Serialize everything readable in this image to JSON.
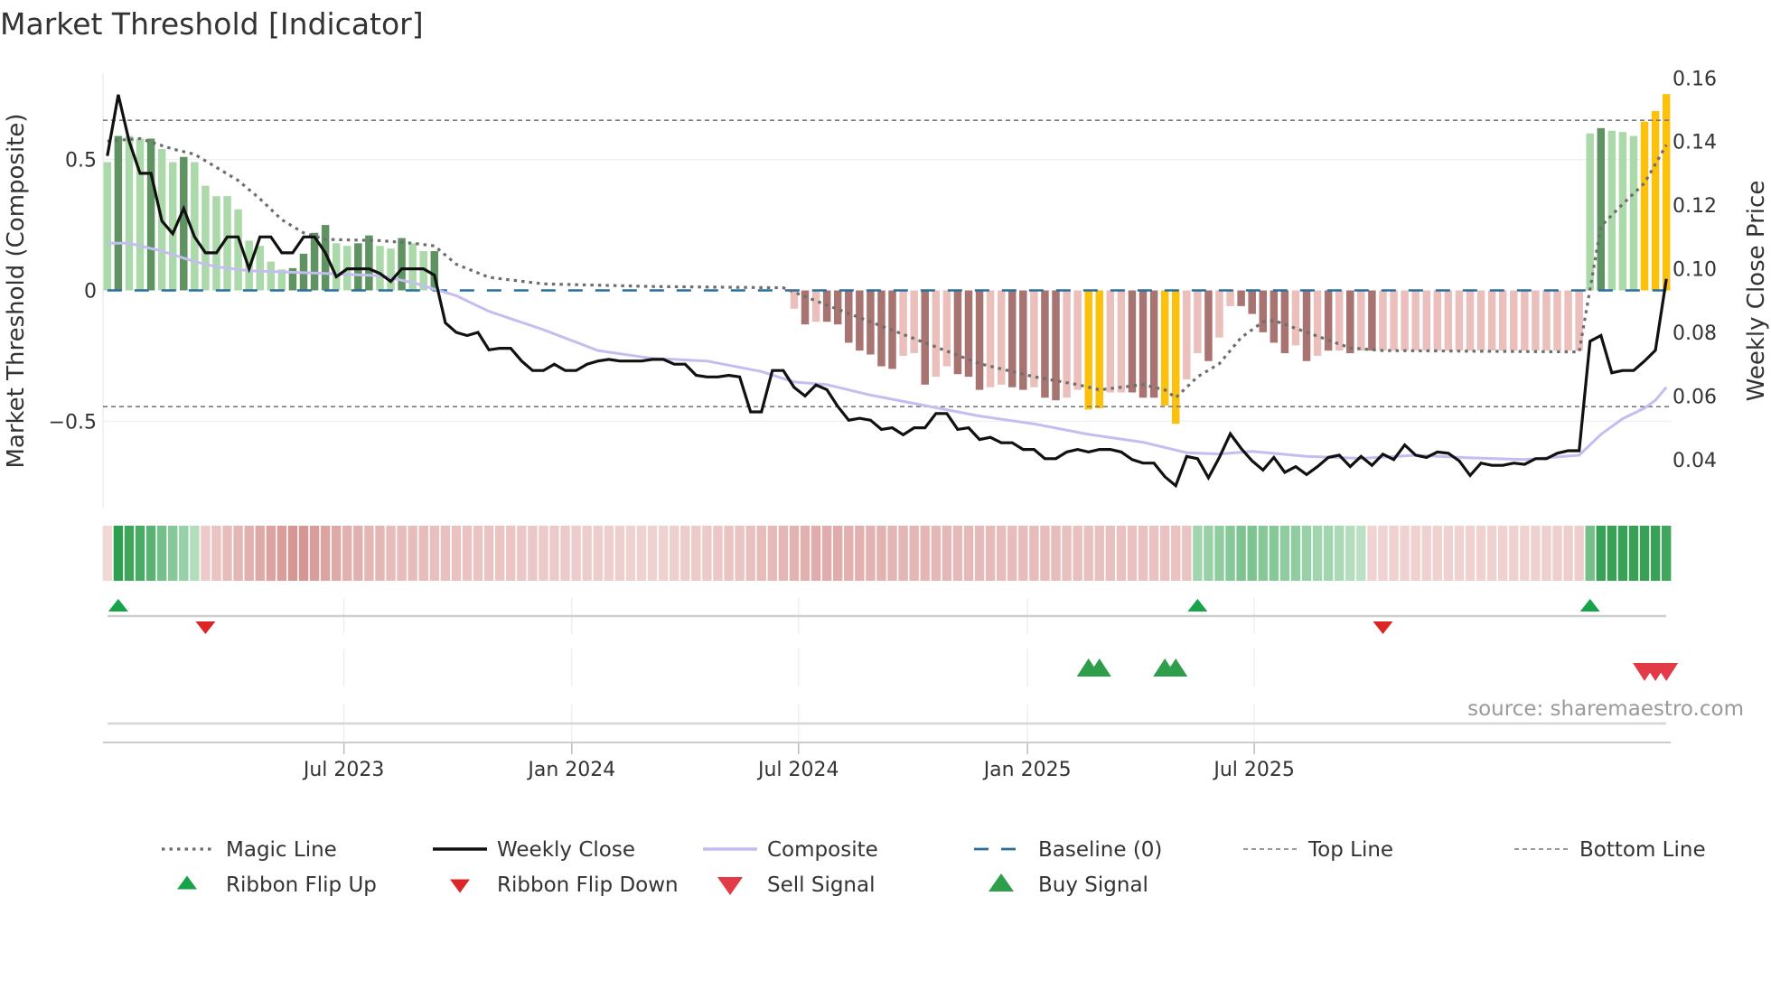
{
  "title": "Market Threshold [Indicator]",
  "source": "source: sharemaestro.com",
  "colors": {
    "bar_pos_light": "#acd9a9",
    "bar_pos_dark": "#5f9462",
    "bar_neg_light": "#ebbfbc",
    "bar_neg_dark": "#a87471",
    "bar_gold": "#fcc10d",
    "weekly_close": "#111111",
    "composite": "#c4bdf0",
    "magic": "#6e6e6e",
    "baseline": "#2a6f9c",
    "threshold": "#7a7a7a",
    "flip_up": "#16a34a",
    "flip_down": "#dc2626",
    "buy": "#2e9e4a",
    "sell": "#e23b47"
  },
  "chart_data": {
    "type": "bar",
    "title": "Market Threshold [Indicator]",
    "ylabel": "Market Threshold (Composite)",
    "ylabel_right": "Weekly Close Price",
    "ylim": [
      -0.83,
      0.83
    ],
    "ylim_right": [
      0.0249,
      0.1615
    ],
    "xlim_weeks": [
      -0.4,
      143.4
    ],
    "yticks": [
      {
        "v": 0.5,
        "label": "0.5"
      },
      {
        "v": 0,
        "label": "0"
      },
      {
        "v": -0.5,
        "label": "−0.5"
      }
    ],
    "yticks_right": [
      {
        "v": 0.16,
        "label": "0.16"
      },
      {
        "v": 0.14,
        "label": "0.14"
      },
      {
        "v": 0.12,
        "label": "0.12"
      },
      {
        "v": 0.1,
        "label": "0.10"
      },
      {
        "v": 0.08,
        "label": "0.08"
      },
      {
        "v": 0.06,
        "label": "0.06"
      },
      {
        "v": 0.04,
        "label": "0.04"
      }
    ],
    "xticks": [
      {
        "week": 21.7,
        "label": "Jul 2023"
      },
      {
        "week": 42.6,
        "label": "Jan 2024"
      },
      {
        "week": 63.4,
        "label": "Jul 2024"
      },
      {
        "week": 84.4,
        "label": "Jan 2025"
      },
      {
        "week": 105.2,
        "label": "Jul 2025"
      }
    ],
    "top_line": 0.65,
    "bottom_line": -0.444,
    "baseline": 0,
    "composite_bars": [
      0.49,
      0.59,
      0.59,
      0.58,
      0.58,
      0.54,
      0.49,
      0.51,
      0.49,
      0.4,
      0.36,
      0.36,
      0.31,
      0.19,
      0.17,
      0.11,
      0.08,
      0.085,
      0.14,
      0.22,
      0.25,
      0.18,
      0.17,
      0.18,
      0.21,
      0.17,
      0.16,
      0.2,
      0.18,
      0.15,
      0.15,
      0,
      0,
      0,
      0,
      0,
      0,
      0,
      0,
      0,
      0,
      0,
      0,
      0,
      0,
      0,
      0,
      0,
      0,
      0,
      0,
      0,
      0,
      0,
      0,
      0,
      0,
      0,
      0,
      0,
      0,
      0,
      0,
      -0.07,
      -0.13,
      -0.12,
      -0.12,
      -0.13,
      -0.2,
      -0.23,
      -0.245,
      -0.29,
      -0.3,
      -0.25,
      -0.24,
      -0.36,
      -0.33,
      -0.29,
      -0.32,
      -0.33,
      -0.38,
      -0.37,
      -0.36,
      -0.37,
      -0.38,
      -0.37,
      -0.41,
      -0.42,
      -0.41,
      -0.38,
      -0.455,
      -0.45,
      -0.39,
      -0.39,
      -0.39,
      -0.41,
      -0.41,
      -0.44,
      -0.51,
      -0.34,
      -0.24,
      -0.27,
      -0.18,
      -0.06,
      -0.06,
      -0.09,
      -0.16,
      -0.2,
      -0.24,
      -0.21,
      -0.27,
      -0.25,
      -0.23,
      -0.23,
      -0.24,
      -0.23,
      -0.23,
      -0.23,
      -0.23,
      -0.23,
      -0.23,
      -0.23,
      -0.23,
      -0.23,
      -0.23,
      -0.23,
      -0.23,
      -0.23,
      -0.23,
      -0.23,
      -0.23,
      -0.23,
      -0.23,
      -0.23,
      -0.23,
      -0.23,
      0.6,
      0.62,
      0.61,
      0.605,
      0.59,
      0.645,
      0.685,
      0.75
    ],
    "bar_shade": [
      1,
      2,
      1,
      1,
      2,
      1,
      1,
      2,
      1,
      1,
      1,
      1,
      1,
      1,
      1,
      1,
      1,
      2,
      2,
      2,
      2,
      1,
      1,
      2,
      2,
      1,
      1,
      2,
      1,
      1,
      2,
      0,
      0,
      0,
      0,
      0,
      0,
      0,
      0,
      0,
      0,
      0,
      0,
      0,
      0,
      0,
      0,
      0,
      0,
      0,
      0,
      0,
      0,
      0,
      0,
      0,
      0,
      0,
      0,
      0,
      0,
      0,
      0,
      1,
      2,
      1,
      2,
      2,
      2,
      2,
      2,
      2,
      2,
      1,
      1,
      2,
      1,
      1,
      2,
      2,
      2,
      1,
      1,
      2,
      2,
      1,
      2,
      2,
      1,
      1,
      3,
      3,
      1,
      1,
      2,
      2,
      2,
      3,
      3,
      1,
      1,
      2,
      1,
      1,
      2,
      2,
      2,
      2,
      2,
      1,
      2,
      1,
      2,
      1,
      2,
      1,
      2,
      1,
      1,
      1,
      1,
      1,
      1,
      1,
      1,
      1,
      1,
      1,
      1,
      1,
      1,
      1,
      1,
      1,
      1,
      1,
      1,
      2,
      1,
      1,
      1,
      3,
      3,
      3
    ],
    "weekly_close": [
      0.1355,
      0.1547,
      0.14,
      0.13,
      0.13,
      0.115,
      0.111,
      0.119,
      0.11,
      0.105,
      0.105,
      0.11,
      0.11,
      0.1,
      0.11,
      0.11,
      0.105,
      0.105,
      0.11,
      0.11,
      0.105,
      0.0975,
      0.1,
      0.1,
      0.1,
      0.0985,
      0.096,
      0.1,
      0.1,
      0.1,
      0.098,
      0.083,
      0.08,
      0.079,
      0.08,
      0.0745,
      0.075,
      0.075,
      0.071,
      0.068,
      0.068,
      0.07,
      0.068,
      0.068,
      0.07,
      0.071,
      0.0715,
      0.071,
      0.071,
      0.071,
      0.0715,
      0.0715,
      0.07,
      0.07,
      0.0665,
      0.066,
      0.066,
      0.0665,
      0.066,
      0.055,
      0.055,
      0.068,
      0.068,
      0.0627,
      0.06,
      0.0635,
      0.062,
      0.0567,
      0.0524,
      0.053,
      0.0524,
      0.0495,
      0.05,
      0.0478,
      0.05,
      0.05,
      0.0545,
      0.0545,
      0.0495,
      0.05,
      0.0463,
      0.047,
      0.0453,
      0.0453,
      0.0432,
      0.0432,
      0.0403,
      0.0403,
      0.0424,
      0.0432,
      0.0424,
      0.0432,
      0.0432,
      0.0424,
      0.04,
      0.0389,
      0.0389,
      0.0346,
      0.0318,
      0.041,
      0.0403,
      0.0343,
      0.0407,
      0.0481,
      0.0435,
      0.0396,
      0.0367,
      0.0407,
      0.036,
      0.0378,
      0.0353,
      0.0378,
      0.0407,
      0.0414,
      0.0378,
      0.041,
      0.0382,
      0.0417,
      0.04,
      0.0446,
      0.0414,
      0.0407,
      0.0424,
      0.042,
      0.0396,
      0.035,
      0.0389,
      0.0382,
      0.0382,
      0.0389,
      0.0385,
      0.0403,
      0.0403,
      0.042,
      0.0428,
      0.0428,
      0.0772,
      0.079,
      0.0673,
      0.068,
      0.068,
      0.071,
      0.0744,
      0.0968
    ],
    "composite_line": [
      [
        0,
        0.18
      ],
      [
        2,
        0.18
      ],
      [
        5,
        0.15
      ],
      [
        8,
        0.11
      ],
      [
        10,
        0.09
      ],
      [
        13,
        0.075
      ],
      [
        20,
        0.065
      ],
      [
        25,
        0.056
      ],
      [
        28,
        0.03
      ],
      [
        30,
        0.005
      ],
      [
        32,
        -0.02
      ],
      [
        35,
        -0.08
      ],
      [
        40,
        -0.15
      ],
      [
        45,
        -0.23
      ],
      [
        50,
        -0.26
      ],
      [
        55,
        -0.27
      ],
      [
        60,
        -0.31
      ],
      [
        63,
        -0.35
      ],
      [
        66,
        -0.36
      ],
      [
        70,
        -0.4
      ],
      [
        75,
        -0.44
      ],
      [
        80,
        -0.48
      ],
      [
        85,
        -0.51
      ],
      [
        90,
        -0.55
      ],
      [
        95,
        -0.58
      ],
      [
        99,
        -0.62
      ],
      [
        102,
        -0.625
      ],
      [
        105,
        -0.615
      ],
      [
        110,
        -0.634
      ],
      [
        115,
        -0.642
      ],
      [
        120,
        -0.63
      ],
      [
        125,
        -0.64
      ],
      [
        130,
        -0.646
      ],
      [
        135,
        -0.63
      ],
      [
        137,
        -0.55
      ],
      [
        139,
        -0.49
      ],
      [
        141,
        -0.45
      ],
      [
        142,
        -0.42
      ],
      [
        143,
        -0.37
      ]
    ],
    "magic_line": [
      [
        0,
        0.57
      ],
      [
        3,
        0.58
      ],
      [
        6,
        0.54
      ],
      [
        8,
        0.52
      ],
      [
        10,
        0.47
      ],
      [
        12,
        0.42
      ],
      [
        14,
        0.35
      ],
      [
        16,
        0.27
      ],
      [
        18,
        0.22
      ],
      [
        20,
        0.195
      ],
      [
        25,
        0.19
      ],
      [
        28,
        0.18
      ],
      [
        30,
        0.17
      ],
      [
        32,
        0.1
      ],
      [
        35,
        0.05
      ],
      [
        40,
        0.025
      ],
      [
        50,
        0.015
      ],
      [
        62,
        0.01
      ],
      [
        65,
        -0.04
      ],
      [
        70,
        -0.12
      ],
      [
        75,
        -0.2
      ],
      [
        80,
        -0.28
      ],
      [
        85,
        -0.33
      ],
      [
        89,
        -0.36
      ],
      [
        91,
        -0.38
      ],
      [
        95,
        -0.36
      ],
      [
        97,
        -0.38
      ],
      [
        98,
        -0.41
      ],
      [
        100,
        -0.33
      ],
      [
        102,
        -0.28
      ],
      [
        104,
        -0.18
      ],
      [
        106,
        -0.12
      ],
      [
        107,
        -0.115
      ],
      [
        110,
        -0.16
      ],
      [
        114,
        -0.22
      ],
      [
        117,
        -0.23
      ],
      [
        135,
        -0.235
      ],
      [
        137,
        0.245
      ],
      [
        139,
        0.33
      ],
      [
        141,
        0.41
      ],
      [
        143,
        0.556
      ]
    ],
    "ribbon": [
      -0.1,
      0.95,
      0.85,
      0.8,
      0.7,
      0.55,
      0.45,
      0.35,
      0.2,
      -0.2,
      -0.25,
      -0.3,
      -0.35,
      -0.4,
      -0.45,
      -0.5,
      -0.55,
      -0.6,
      -0.6,
      -0.55,
      -0.5,
      -0.45,
      -0.4,
      -0.4,
      -0.35,
      -0.35,
      -0.3,
      -0.3,
      -0.3,
      -0.3,
      -0.28,
      -0.28,
      -0.26,
      -0.26,
      -0.25,
      -0.25,
      -0.24,
      -0.24,
      -0.22,
      -0.22,
      -0.2,
      -0.2,
      -0.2,
      -0.18,
      -0.18,
      -0.18,
      -0.16,
      -0.16,
      -0.15,
      -0.15,
      -0.15,
      -0.15,
      -0.16,
      -0.18,
      -0.2,
      -0.2,
      -0.22,
      -0.25,
      -0.25,
      -0.28,
      -0.3,
      -0.32,
      -0.35,
      -0.38,
      -0.4,
      -0.42,
      -0.42,
      -0.42,
      -0.4,
      -0.4,
      -0.38,
      -0.38,
      -0.36,
      -0.36,
      -0.35,
      -0.35,
      -0.34,
      -0.34,
      -0.33,
      -0.33,
      -0.32,
      -0.32,
      -0.3,
      -0.3,
      -0.3,
      -0.3,
      -0.3,
      -0.3,
      -0.28,
      -0.28,
      -0.28,
      -0.28,
      -0.28,
      -0.27,
      -0.27,
      -0.27,
      -0.26,
      -0.26,
      -0.26,
      -0.25,
      0.3,
      0.35,
      0.4,
      0.45,
      0.5,
      0.5,
      0.45,
      0.45,
      0.4,
      0.4,
      0.35,
      0.3,
      0.3,
      0.25,
      0.2,
      0.15,
      -0.12,
      -0.14,
      -0.15,
      -0.15,
      -0.15,
      -0.15,
      -0.15,
      -0.15,
      -0.15,
      -0.15,
      -0.15,
      -0.15,
      -0.15,
      -0.15,
      -0.15,
      -0.15,
      -0.16,
      -0.16,
      -0.17,
      -0.17,
      0.55,
      0.9,
      0.9,
      0.9,
      0.9,
      0.9,
      0.9,
      0.85
    ],
    "ribbon_flip_up_weeks": [
      1,
      100,
      136
    ],
    "ribbon_flip_down_weeks": [
      9,
      117
    ],
    "buy_signal_weeks": [
      90,
      91,
      97,
      98
    ],
    "sell_signal_weeks": [
      141,
      142,
      143
    ],
    "legend": {
      "placement": "bottom",
      "items": [
        {
          "label": "Magic Line",
          "symbol": "dotted-line"
        },
        {
          "label": "Weekly Close",
          "symbol": "solid-line"
        },
        {
          "label": "Composite",
          "symbol": "lavender-line"
        },
        {
          "label": "Baseline (0)",
          "symbol": "dashed-line"
        },
        {
          "label": "Top Line",
          "symbol": "thin-dashed-line"
        },
        {
          "label": "Bottom Line",
          "symbol": "thin-dashed-line"
        },
        {
          "label": "Ribbon Flip Up",
          "symbol": "triangle-up-small"
        },
        {
          "label": "Ribbon Flip Down",
          "symbol": "triangle-down-small"
        },
        {
          "label": "Sell Signal",
          "symbol": "triangle-down-large"
        },
        {
          "label": "Buy Signal",
          "symbol": "triangle-up-large"
        }
      ]
    }
  }
}
